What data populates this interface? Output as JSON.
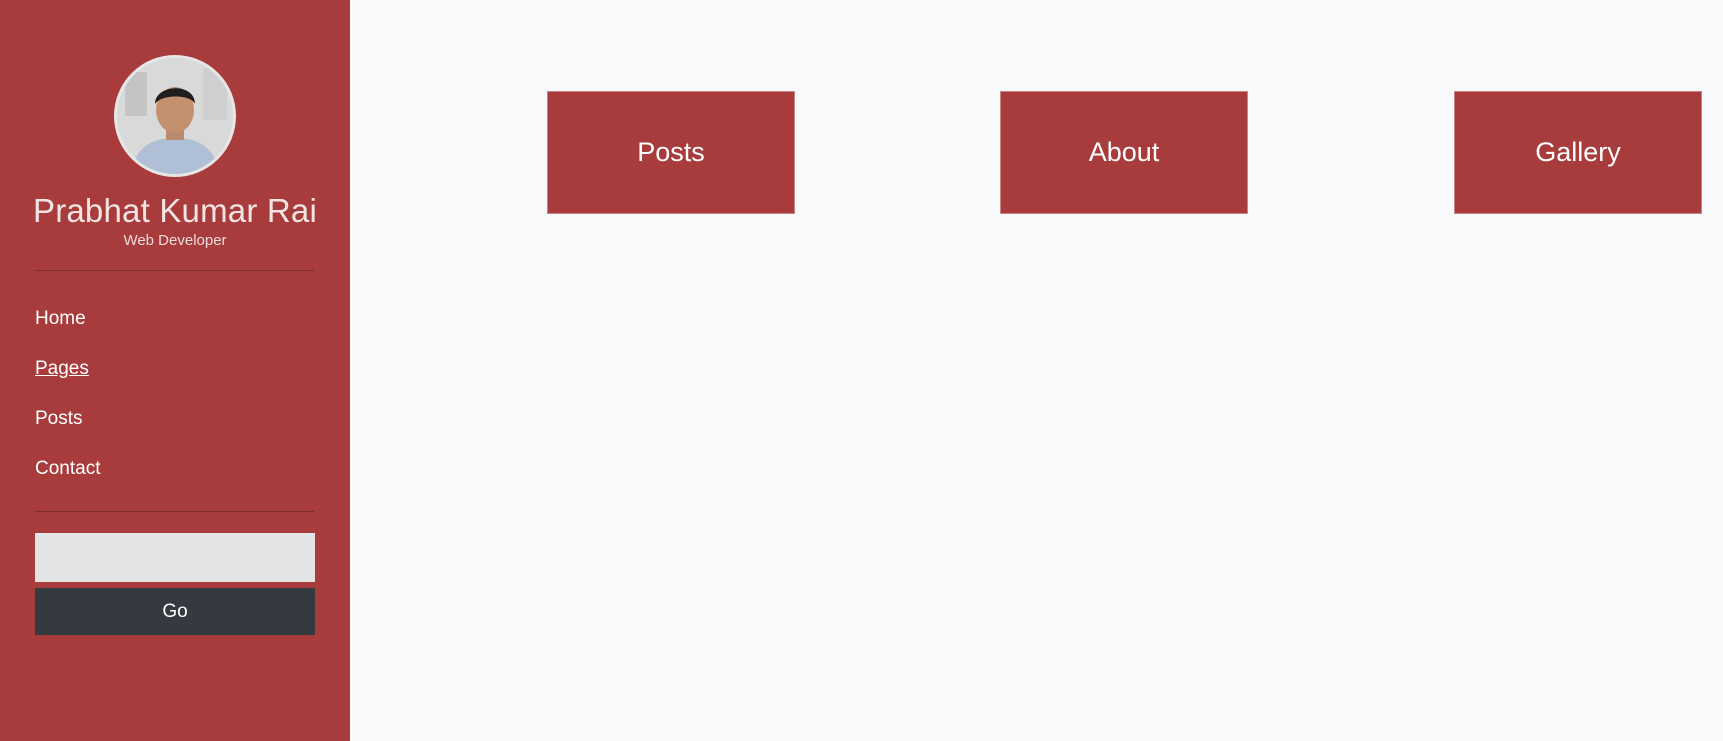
{
  "sidebar": {
    "profile": {
      "name": "Prabhat Kumar Rai",
      "role": "Web Developer",
      "avatar_icon": "user-photo"
    },
    "nav_items": [
      {
        "label": "Home",
        "active": false
      },
      {
        "label": "Pages",
        "active": true
      },
      {
        "label": "Posts",
        "active": false
      },
      {
        "label": "Contact",
        "active": false
      }
    ],
    "search": {
      "value": "",
      "placeholder": ""
    },
    "go_label": "Go"
  },
  "main": {
    "cards": [
      {
        "label": "Posts"
      },
      {
        "label": "About"
      },
      {
        "label": "Gallery"
      }
    ]
  },
  "colors": {
    "sidebar_bg": "#a83c3c",
    "card_bg": "#a83c3c",
    "button_bg": "#343a40",
    "page_bg": "#f8f9fa",
    "input_bg": "#e4e4e4"
  }
}
